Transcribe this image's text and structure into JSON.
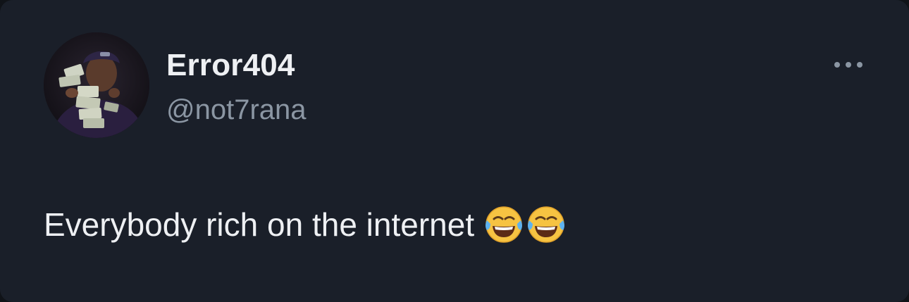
{
  "tweet": {
    "author": {
      "display_name": "Error404",
      "handle": "@not7rana",
      "avatar_icon": "profile-avatar"
    },
    "text": "Everybody rich on the internet",
    "emojis": [
      "face-with-tears-of-joy",
      "face-with-tears-of-joy"
    ],
    "menu_icon": "more-options-icon"
  },
  "theme": {
    "background": "#1a1f29",
    "primary_text": "#eef0f3",
    "secondary_text": "#8b96a3"
  }
}
